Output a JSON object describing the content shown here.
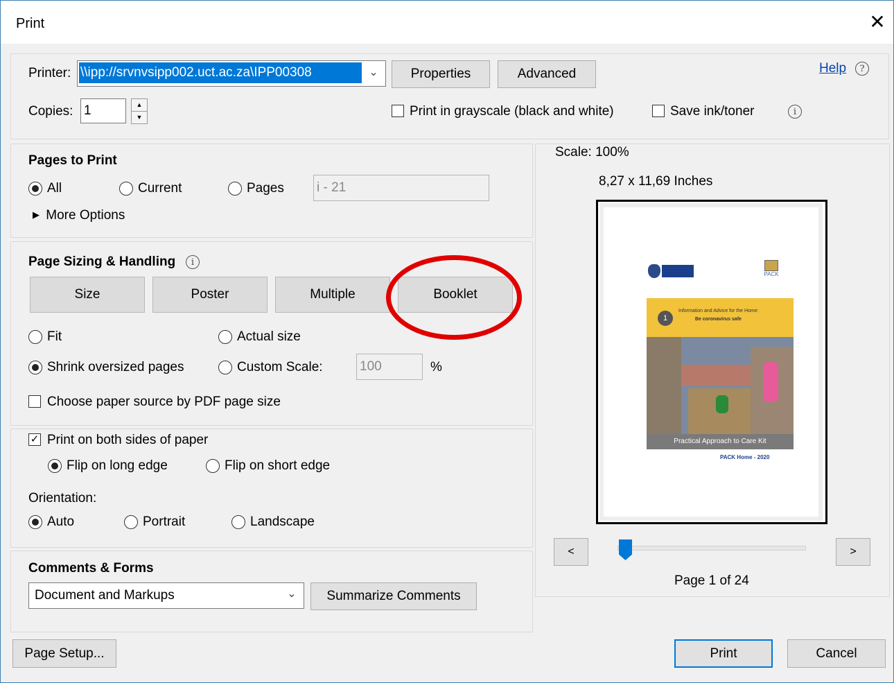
{
  "window": {
    "title": "Print",
    "close_glyph": "✕"
  },
  "printer": {
    "printer_label": "Printer:",
    "printer_value": "\\\\ipp://srvnvsipp002.uct.ac.za\\IPP00308",
    "copies_label": "Copies:",
    "copies_value": "1",
    "properties_label": "Properties",
    "advanced_label": "Advanced",
    "help_label": "Help",
    "grayscale_label": "Print in grayscale (black and white)",
    "grayscale_checked": false,
    "save_ink_label": "Save ink/toner",
    "save_ink_checked": false
  },
  "pages_to_print": {
    "heading": "Pages to Print",
    "all_label": "All",
    "current_label": "Current",
    "pages_label": "Pages",
    "pages_value": "i - 21",
    "selected": "All",
    "more_options_label": "More Options"
  },
  "page_sizing": {
    "heading": "Page Sizing & Handling",
    "tabs": [
      "Size",
      "Poster",
      "Multiple",
      "Booklet"
    ],
    "fit_label": "Fit",
    "actual_size_label": "Actual size",
    "shrink_label": "Shrink oversized pages",
    "custom_scale_label": "Custom Scale:",
    "custom_scale_value": "100",
    "percent_sign": "%",
    "selected": "Shrink oversized pages",
    "paper_source_label": "Choose paper source by PDF page size",
    "paper_source_checked": false,
    "highlight_color": "#e00000"
  },
  "duplex": {
    "both_sides_label": "Print on both sides of paper",
    "both_sides_checked": true,
    "long_edge_label": "Flip on long edge",
    "short_edge_label": "Flip on short edge",
    "selected": "Flip on long edge"
  },
  "orientation": {
    "label": "Orientation:",
    "auto_label": "Auto",
    "portrait_label": "Portrait",
    "landscape_label": "Landscape",
    "selected": "Auto"
  },
  "comments_forms": {
    "heading": "Comments & Forms",
    "selected_option": "Document and Markups",
    "summarize_label": "Summarize Comments"
  },
  "preview": {
    "scale_text": "Scale: 100%",
    "size_text": "8,27 x 11,69 Inches",
    "page_text": "Page 1 of 24",
    "prev_label": "<",
    "next_label": ">",
    "slider_position": 0.0,
    "cover": {
      "title_line1": "Information and Advice for the Home:",
      "title_line2": "Be coronavirus safe",
      "number": "1",
      "banner": "Practical Approach to Care Kit",
      "footer": "PACK Home - 2020",
      "logo_right": "PACK"
    }
  },
  "footer": {
    "page_setup_label": "Page Setup...",
    "print_label": "Print",
    "cancel_label": "Cancel"
  },
  "colors": {
    "accent": "#0078d7",
    "link": "#0645ad",
    "selection": "#0078d7"
  }
}
